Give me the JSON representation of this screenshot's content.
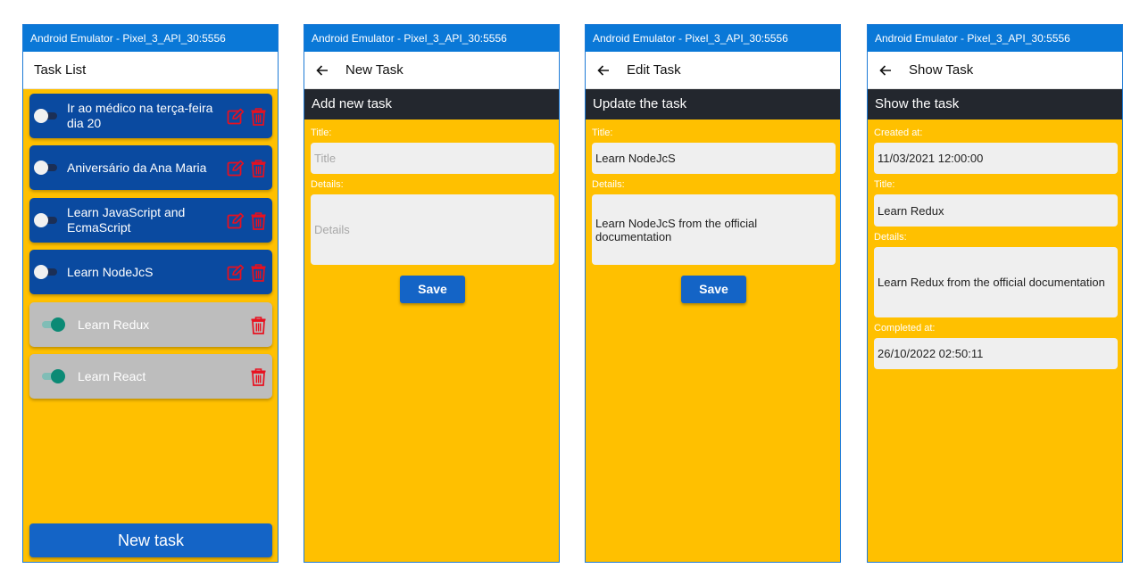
{
  "colors": {
    "titlebar": "#0a78d7",
    "background": "#ffc000",
    "task_pending": "#0a4aa0",
    "task_done": "#bdbdbd",
    "button": "#1464c6",
    "danger_icon": "#e8101f",
    "subheader": "#23272e"
  },
  "screen1": {
    "window_title": "Android Emulator - Pixel_3_API_30:5556",
    "app_title": "Task List",
    "tasks": [
      {
        "title": "Ir ao médico na terça-feira dia 20",
        "completed": false
      },
      {
        "title": "Aniversário da Ana Maria",
        "completed": false
      },
      {
        "title": "Learn JavaScript and EcmaScript",
        "completed": false
      },
      {
        "title": "Learn NodeJcS",
        "completed": false
      },
      {
        "title": "Learn Redux",
        "completed": true
      },
      {
        "title": "Learn React",
        "completed": true
      }
    ],
    "new_task_button": "New task",
    "icons": {
      "edit": "edit-icon",
      "delete": "trash-icon",
      "toggle": "switch-toggle"
    }
  },
  "screen2": {
    "window_title": "Android Emulator - Pixel_3_API_30:5556",
    "app_title": "New Task",
    "subheader": "Add new task",
    "title_label": "Title:",
    "title_placeholder": "Title",
    "details_label": "Details:",
    "details_placeholder": "Details",
    "save_button": "Save"
  },
  "screen3": {
    "window_title": "Android Emulator - Pixel_3_API_30:5556",
    "app_title": "Edit Task",
    "subheader": "Update the task",
    "title_label": "Title:",
    "title_value": "Learn NodeJcS",
    "details_label": "Details:",
    "details_value": "Learn NodeJcS from the official documentation",
    "save_button": "Save"
  },
  "screen4": {
    "window_title": "Android Emulator - Pixel_3_API_30:5556",
    "app_title": "Show Task",
    "subheader": "Show the task",
    "created_label": "Created at:",
    "created_value": "11/03/2021 12:00:00",
    "title_label": "Title:",
    "title_value": "Learn Redux",
    "details_label": "Details:",
    "details_value": "Learn Redux from the official documentation",
    "completed_label": "Completed at:",
    "completed_value": "26/10/2022 02:50:11"
  }
}
